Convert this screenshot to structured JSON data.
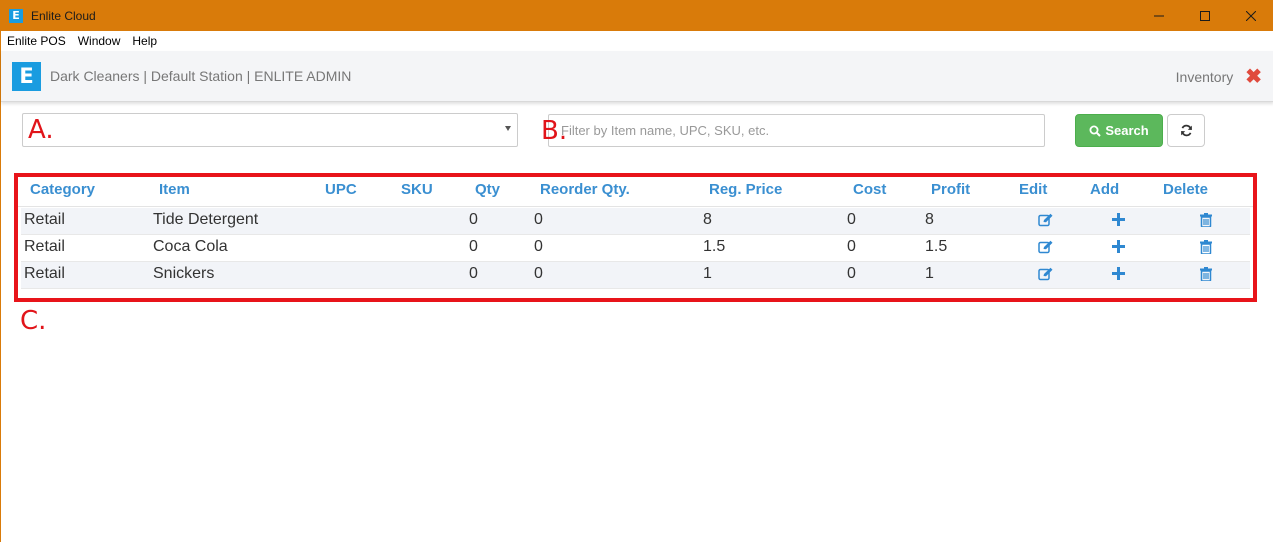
{
  "window": {
    "title": "Enlite Cloud",
    "logo_letter": "E"
  },
  "menu": [
    "Enlite POS",
    "Window",
    "Help"
  ],
  "header": {
    "logo_letter": "E",
    "brand": "Dark Cleaners | Default Station | ENLITE ADMIN",
    "section": "Inventory"
  },
  "toolbar": {
    "select_value": "",
    "filter_placeholder": "Filter by Item name, UPC, SKU, etc.",
    "search_label": "Search"
  },
  "annotations": {
    "a": "A.",
    "b": "B.",
    "c": "C."
  },
  "table": {
    "columns": [
      "Category",
      "Item",
      "UPC",
      "SKU",
      "Qty",
      "Reorder Qty.",
      "Reg. Price",
      "Cost",
      "Profit",
      "Edit",
      "Add",
      "Delete"
    ],
    "rows": [
      {
        "category": "Retail",
        "item": "Tide Detergent",
        "upc": "",
        "sku": "",
        "qty": "0",
        "reorder": "0",
        "price": "8",
        "cost": "0",
        "profit": "8"
      },
      {
        "category": "Retail",
        "item": "Coca Cola",
        "upc": "",
        "sku": "",
        "qty": "0",
        "reorder": "0",
        "price": "1.5",
        "cost": "0",
        "profit": "1.5"
      },
      {
        "category": "Retail",
        "item": "Snickers",
        "upc": "",
        "sku": "",
        "qty": "0",
        "reorder": "0",
        "price": "1",
        "cost": "0",
        "profit": "1"
      }
    ]
  },
  "colors": {
    "titlebar": "#d97b0a",
    "brand_blue": "#1a9ce0",
    "header_link": "#3a8fd1",
    "search_green": "#5cb85c",
    "annotation_red": "#e1141a"
  }
}
